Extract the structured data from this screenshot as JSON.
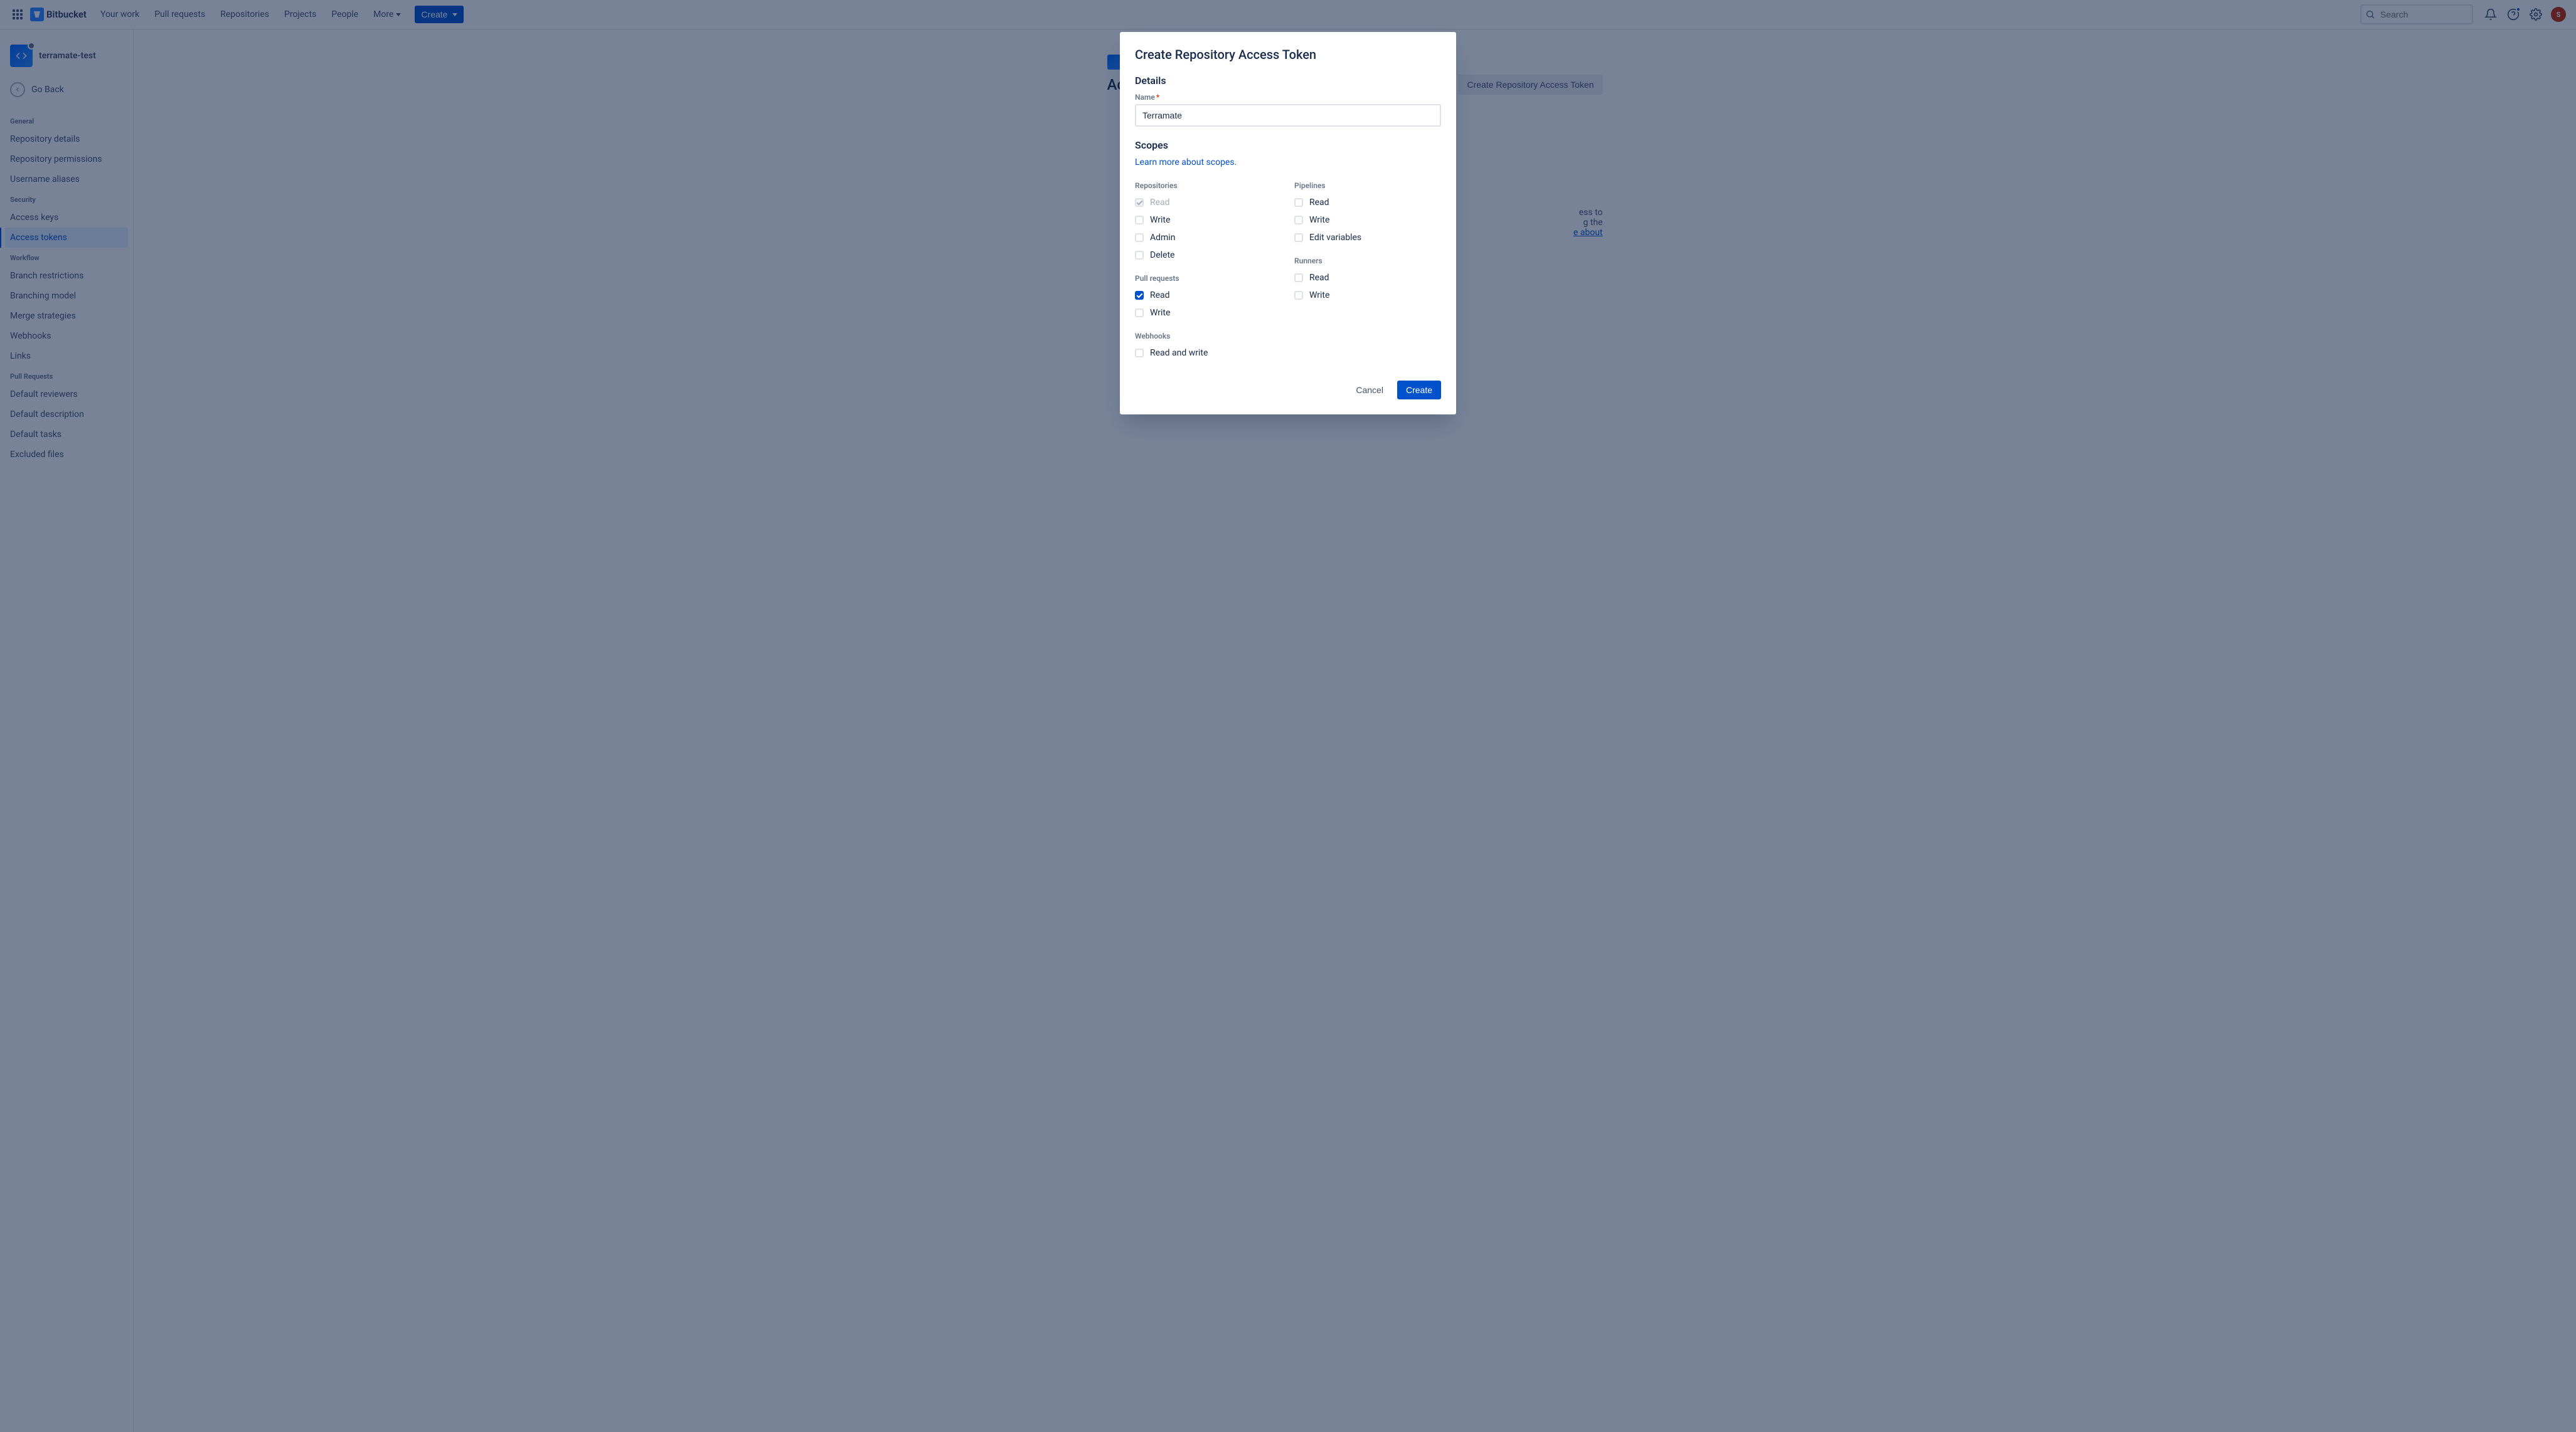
{
  "brand": {
    "name": "Bitbucket"
  },
  "topnav": {
    "your_work": "Your work",
    "pull_requests": "Pull requests",
    "repositories": "Repositories",
    "projects": "Projects",
    "people": "People",
    "more": "More",
    "create": "Create",
    "search_placeholder": "Search"
  },
  "avatar_initial": "S",
  "sidebar": {
    "repo_name": "terramate-test",
    "go_back": "Go Back",
    "sections": {
      "general": {
        "title": "General",
        "items": {
          "repo_details": "Repository details",
          "repo_permissions": "Repository permissions",
          "username_aliases": "Username aliases"
        }
      },
      "security": {
        "title": "Security",
        "items": {
          "access_keys": "Access keys",
          "access_tokens": "Access tokens"
        }
      },
      "workflow": {
        "title": "Workflow",
        "items": {
          "branch_restrictions": "Branch restrictions",
          "branching_model": "Branching model",
          "merge_strategies": "Merge strategies",
          "webhooks": "Webhooks",
          "links": "Links"
        }
      },
      "pull_requests": {
        "title": "Pull Requests",
        "items": {
          "default_reviewers": "Default reviewers",
          "default_description": "Default description",
          "default_tasks": "Default tasks",
          "excluded_files": "Excluded files"
        }
      }
    }
  },
  "page": {
    "title_partial": "Ac",
    "cta": "Create Repository Access Token",
    "hint_access_to": "ess to",
    "hint_ing_the": "g the",
    "hint_about": "e about"
  },
  "modal": {
    "title": "Create Repository Access Token",
    "details_heading": "Details",
    "name_label": "Name",
    "name_value": "Terramate",
    "scopes_heading": "Scopes",
    "scopes_link": "Learn more about scopes.",
    "groups": {
      "repositories": {
        "title": "Repositories",
        "read": "Read",
        "write": "Write",
        "admin": "Admin",
        "delete": "Delete"
      },
      "pull_requests": {
        "title": "Pull requests",
        "read": "Read",
        "write": "Write"
      },
      "webhooks": {
        "title": "Webhooks",
        "read_write": "Read and write"
      },
      "pipelines": {
        "title": "Pipelines",
        "read": "Read",
        "write": "Write",
        "edit_vars": "Edit variables"
      },
      "runners": {
        "title": "Runners",
        "read": "Read",
        "write": "Write"
      }
    },
    "cancel": "Cancel",
    "create": "Create"
  }
}
